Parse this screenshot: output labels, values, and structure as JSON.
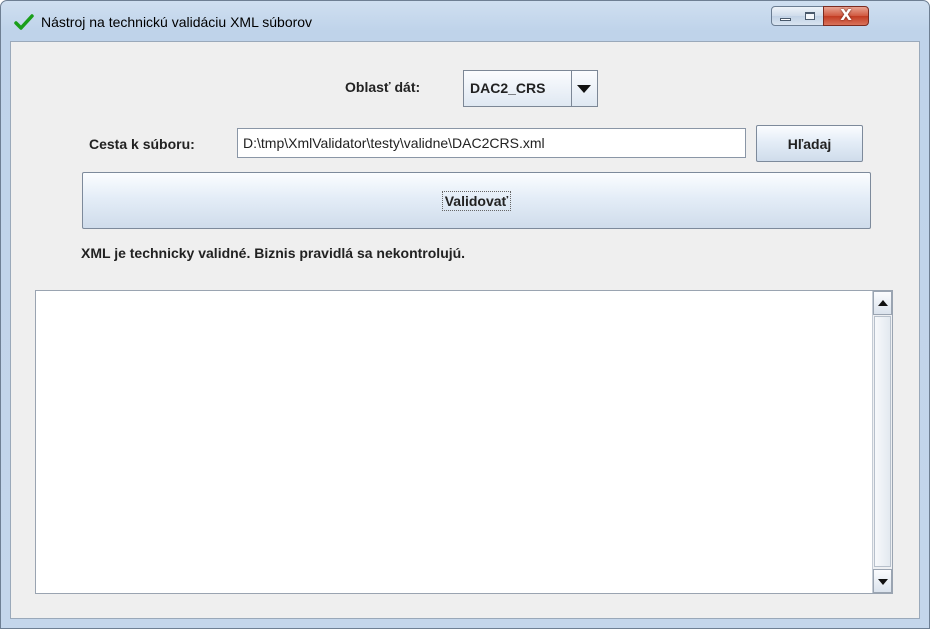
{
  "window": {
    "title": "Nástroj na technickú validáciu XML súborov",
    "close_glyph": "X"
  },
  "form": {
    "area_label": "Oblasť dát:",
    "area_selected": "DAC2_CRS",
    "path_label": "Cesta k súboru:",
    "path_value": "D:\\tmp\\XmlValidator\\testy\\validne\\DAC2CRS.xml",
    "browse_label": "Hľadaj",
    "validate_label": "Validovať"
  },
  "result": {
    "status_message": "XML je technicky validné. Biznis pravidlá sa nekontrolujú.",
    "output_text": ""
  },
  "colors": {
    "check_icon": "#1a9e1a",
    "close_button": "#c8442a",
    "client_background": "#efefef"
  }
}
